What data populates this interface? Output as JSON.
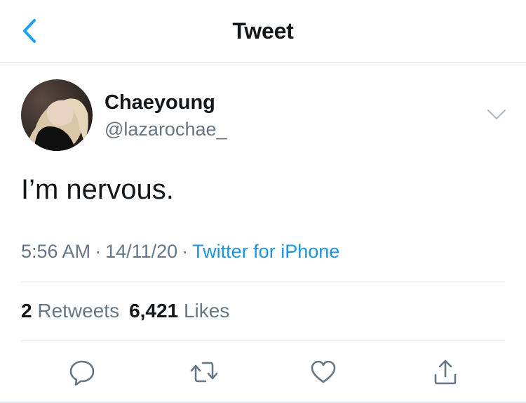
{
  "header": {
    "title": "Tweet"
  },
  "tweet": {
    "author_name": "Chaeyoung",
    "author_handle": "@lazarochae_",
    "text": "I’m nervous.",
    "time": "5:56 AM",
    "date": "14/11/20",
    "separator": "·",
    "source": "Twitter for iPhone",
    "retweet_count": "2",
    "retweet_label": "Retweets",
    "like_count": "6,421",
    "like_label": "Likes"
  },
  "icons": {
    "back": "chevron-left-icon",
    "more": "chevron-down-icon",
    "reply": "reply-icon",
    "retweet": "retweet-icon",
    "like": "heart-icon",
    "share": "share-icon"
  },
  "colors": {
    "accent": "#1da1f2",
    "link": "#1b95e0",
    "text_primary": "#14171a",
    "text_secondary": "#657786",
    "icon_gray": "#657786"
  }
}
